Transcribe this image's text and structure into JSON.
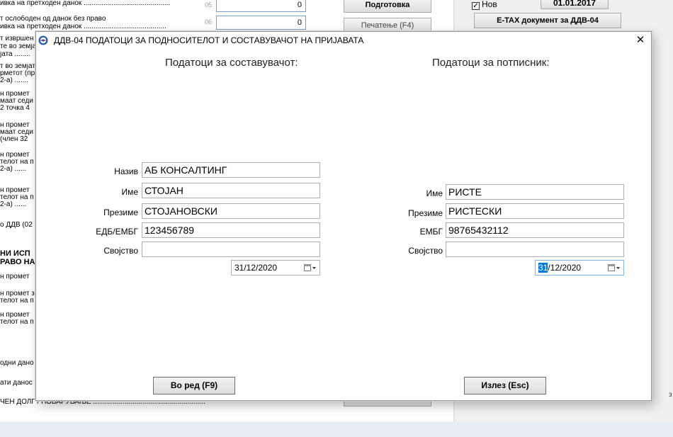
{
  "background": {
    "lines": [
      "ивка на претходен данок ............................................",
      "т ослободен од данок без право",
      "ивка на претходен данок ..........................................",
      "т извршен",
      "те во земја",
      "јата  ........",
      "т во земјата",
      "рметот (пр",
      "2-а)  .......",
      "н промет",
      "маат седи",
      "2 точка 4",
      "н промет",
      "маат седи",
      "(член 32",
      "н промет",
      "телот на п",
      "2-а)  ......",
      "н промет",
      "телот на п",
      "2-а)  ......",
      "о ДДВ (02",
      "НИ ИСП",
      "РАВО НА",
      "н промет",
      "н промет з",
      "телот на п",
      "н промет",
      "телот на п",
      "одни дано",
      "ати данос",
      "ЧЕН ДОЛГ / ПОБАРУВАЊЕ ........................................................."
    ],
    "field_numbers": [
      "05",
      "06"
    ],
    "field_values": [
      "0",
      "0"
    ],
    "btn_podgotovka": "Подготовка",
    "btn_pechatenje": "Печатење (F4)",
    "checkbox_nov_label": "Нов",
    "checkbox_mark": "✓",
    "date_value": "01.01.2017",
    "btn_etax": "E-TAX документ за ДДВ-04",
    "edge_mark": "з"
  },
  "dialog": {
    "title": "ДДВ-04    ПОДАТОЦИ ЗА ПОДНОСИТЕЛОТ И СОСТАВУВАЧОТ НА ПРИЈАВАТА",
    "close_glyph": "✕",
    "composer": {
      "heading": "Податоци за составувачот:",
      "naziv_label": "Назив",
      "naziv_value": "АБ КОНСАЛТИНГ",
      "ime_label": "Име",
      "ime_value": "СТОЈАН",
      "prezime_label": "Презиме",
      "prezime_value": "СТОЈАНОВСКИ",
      "edb_label": "ЕДБ/ЕМБГ",
      "edb_value": "123456789",
      "svojstvo_label": "Својство",
      "svojstvo_value": "",
      "date": "31/12/2020"
    },
    "signer": {
      "heading": "Податоци за потписник:",
      "ime_label": "Име",
      "ime_value": "РИСТЕ",
      "prezime_label": "Презиме",
      "prezime_value": "РИСТЕСКИ",
      "embg_label": "ЕМБГ",
      "embg_value": "98765432112",
      "svojstvo_label": "Својство",
      "svojstvo_value": "",
      "date_selected": "31",
      "date_rest": "/12/2020"
    },
    "btn_ok": "Во ред (F9)",
    "btn_exit": "Излез (Esc)"
  },
  "icons": {
    "app": "app-logo-icon",
    "dropdown": "calendar-dropdown-icon",
    "close": "close-icon"
  }
}
